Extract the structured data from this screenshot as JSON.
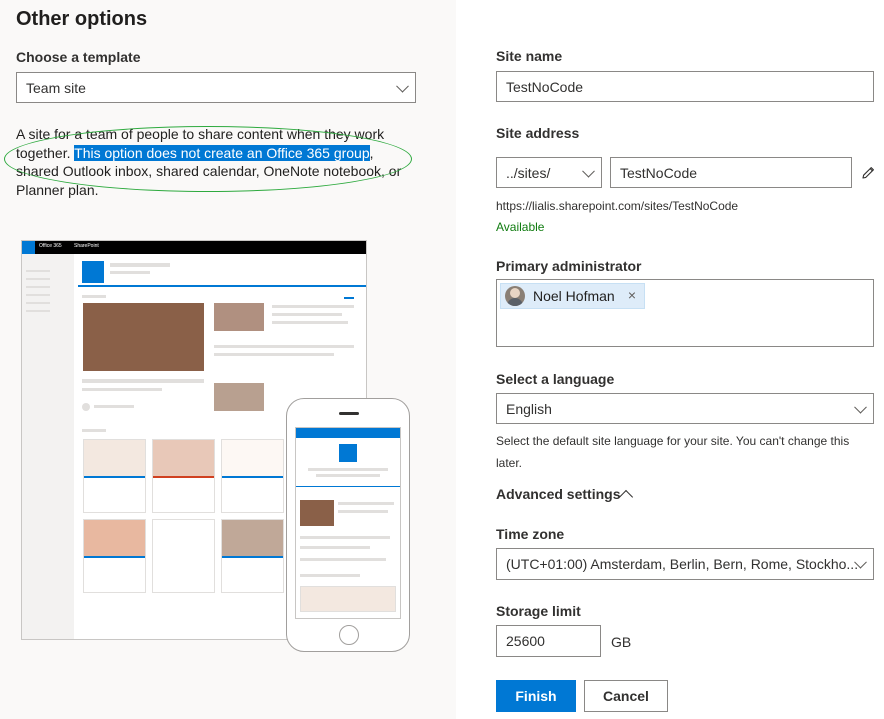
{
  "left": {
    "title": "Other options",
    "template_label": "Choose a template",
    "template_value": "Team site",
    "description_part1": "A site for a team of people to share content when they work together. ",
    "description_highlight": "This option does not create an Office 365 group",
    "description_part2": ", shared Outlook inbox, shared calendar, OneNote notebook, or Planner plan.",
    "preview": {
      "app_name": "Office 365",
      "product_name": "SharePoint"
    }
  },
  "right": {
    "site_name_label": "Site name",
    "site_name_value": "TestNoCode",
    "site_address_label": "Site address",
    "site_address_prefix": "../sites/",
    "site_address_value": "TestNoCode",
    "site_url": "https://lialis.sharepoint.com/sites/TestNoCode",
    "availability": "Available",
    "primary_admin_label": "Primary administrator",
    "primary_admin_name": "Noel Hofman",
    "language_label": "Select a language",
    "language_value": "English",
    "language_help": "Select the default site language for your site. You can't change this later.",
    "advanced_label": "Advanced settings",
    "timezone_label": "Time zone",
    "timezone_value": "(UTC+01:00) Amsterdam, Berlin, Bern, Rome, Stockho...",
    "storage_label": "Storage limit",
    "storage_value": "25600",
    "storage_unit": "GB",
    "finish_label": "Finish",
    "cancel_label": "Cancel"
  },
  "colors": {
    "primary": "#0078d4",
    "available": "#107c10",
    "annotation": "#2eaa3f",
    "left_panel_bg": "#faf9f8"
  }
}
